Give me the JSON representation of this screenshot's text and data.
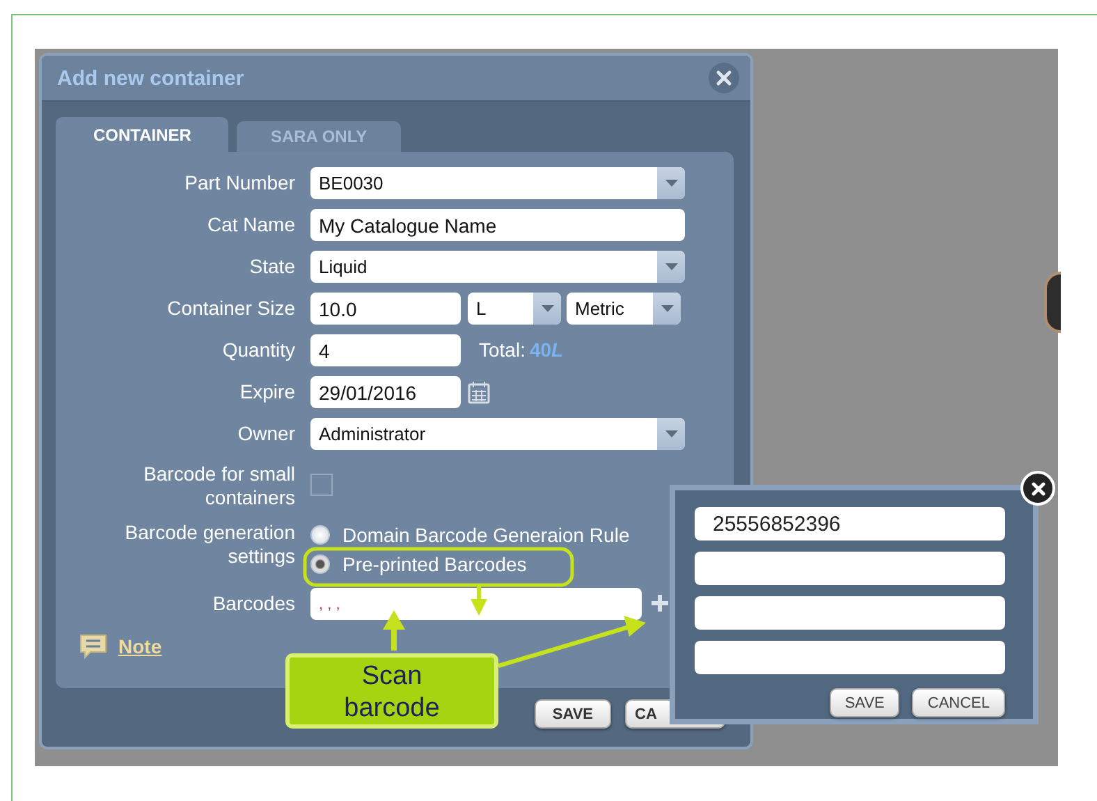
{
  "dialog": {
    "title": "Add new container",
    "tabs": [
      {
        "label": "CONTAINER",
        "selected": true
      },
      {
        "label": "SARA ONLY",
        "selected": false
      }
    ],
    "fields": [
      {
        "kind": "select",
        "label": "Part Number",
        "value": "BE0030"
      },
      {
        "kind": "text",
        "label": "Cat Name",
        "value": "My Catalogue Name"
      },
      {
        "kind": "select",
        "label": "State",
        "value": "Liquid"
      },
      {
        "kind": "size",
        "label": "Container Size",
        "value": "10.0",
        "unit": "L",
        "system": "Metric"
      },
      {
        "kind": "quantity",
        "label": "Quantity",
        "value": "4",
        "total_label": "Total:",
        "total_value": "40",
        "total_unit": "L"
      },
      {
        "kind": "date",
        "label": "Expire",
        "value": "29/01/2016"
      },
      {
        "kind": "select",
        "label": "Owner",
        "value": "Administrator"
      },
      {
        "kind": "checkbox",
        "label": "Barcode for small containers",
        "checked": false
      },
      {
        "kind": "radio",
        "label": "Barcode generation settings",
        "options": [
          {
            "label": "Domain Barcode Generaion Rule",
            "selected": false
          },
          {
            "label": "Pre-printed Barcodes",
            "selected": true
          }
        ]
      },
      {
        "kind": "barcodes",
        "label": "Barcodes",
        "value": ", , ,"
      }
    ],
    "note": "Note",
    "buttons": [
      "SAVE",
      "CA"
    ]
  },
  "barcode_popup": {
    "inputs": [
      {
        "kind": "filled",
        "value": "25556852396"
      },
      {
        "kind": "empty"
      },
      {
        "kind": "empty"
      },
      {
        "kind": "empty"
      }
    ],
    "buttons": [
      "SAVE",
      "CANCEL"
    ]
  },
  "callout": {
    "text": "Scan barcode"
  }
}
